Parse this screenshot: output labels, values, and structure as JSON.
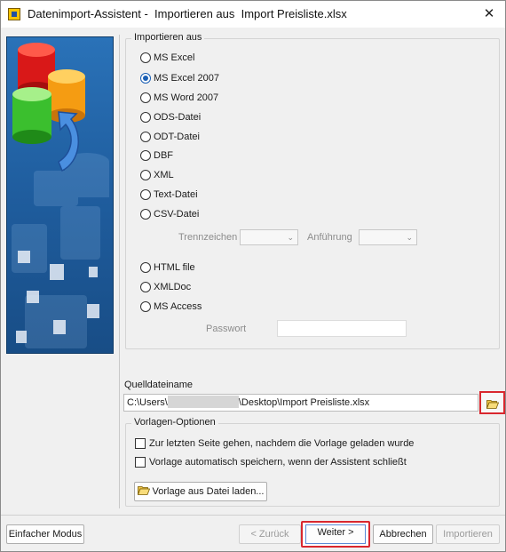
{
  "window": {
    "title": "Datenimport-Assistent -  Importieren aus  Import Preisliste.xlsx",
    "close_glyph": "✕"
  },
  "import_from": {
    "legend": "Importieren aus",
    "options": [
      {
        "label": "MS Excel",
        "checked": false
      },
      {
        "label": "MS Excel 2007",
        "checked": true
      },
      {
        "label": "MS Word 2007",
        "checked": false
      },
      {
        "label": "ODS-Datei",
        "checked": false
      },
      {
        "label": "ODT-Datei",
        "checked": false
      },
      {
        "label": "DBF",
        "checked": false
      },
      {
        "label": "XML",
        "checked": false
      },
      {
        "label": "Text-Datei",
        "checked": false
      },
      {
        "label": "CSV-Datei",
        "checked": false
      },
      {
        "label": "HTML file",
        "checked": false
      },
      {
        "label": "XMLDoc",
        "checked": false
      },
      {
        "label": "MS Access",
        "checked": false
      }
    ],
    "separator_label": "Trennzeichen",
    "quote_label": "Anführung",
    "password_label": "Passwort"
  },
  "source_file": {
    "label": "Quelldateiname",
    "path_prefix": "C:\\Users\\",
    "path_suffix": "\\Desktop\\Import Preisliste.xlsx",
    "browse_icon": "folder-open-icon"
  },
  "templates": {
    "legend": "Vorlagen-Optionen",
    "goto_last_page_label": "Zur letzten Seite gehen, nachdem die Vorlage geladen wurde",
    "autosave_label": "Vorlage automatisch speichern, wenn der Assistent schließt",
    "load_button_label": "Vorlage aus Datei laden..."
  },
  "footer": {
    "simple_mode_label": "Einfacher Modus",
    "back_label": "< Zurück",
    "next_label": "Weiter >",
    "cancel_label": "Abbrechen",
    "import_label": "Importieren"
  },
  "colors": {
    "accent": "#1a5fb4",
    "highlight_box": "#d9272e",
    "side_panel": "#1f5d9e"
  }
}
